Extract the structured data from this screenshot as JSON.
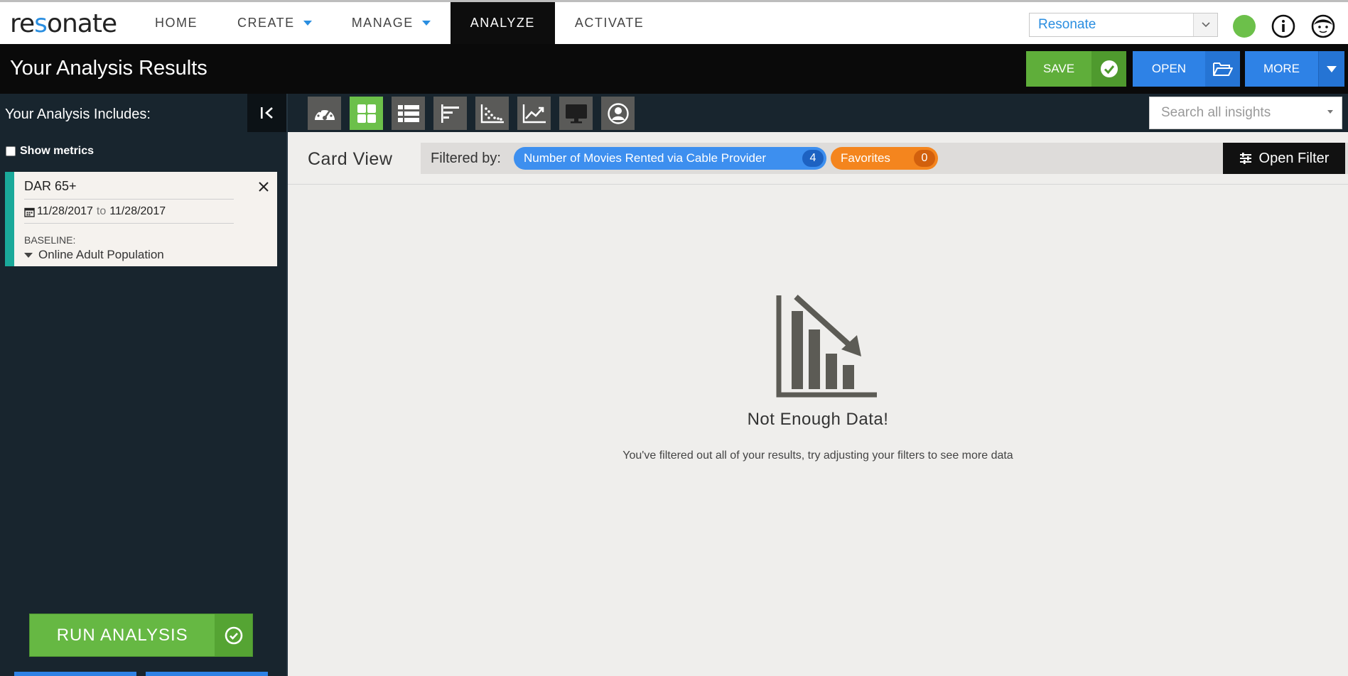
{
  "app": {
    "logo_text_a": "re",
    "logo_text_b": "s",
    "logo_text_c": "onate"
  },
  "nav": {
    "items": [
      {
        "label": "HOME",
        "has_dropdown": false
      },
      {
        "label": "CREATE",
        "has_dropdown": true
      },
      {
        "label": "MANAGE",
        "has_dropdown": true
      },
      {
        "label": "ANALYZE",
        "has_dropdown": false,
        "active": true
      },
      {
        "label": "ACTIVATE",
        "has_dropdown": false
      }
    ],
    "org_select": "Resonate",
    "status_color": "#6cc04a"
  },
  "header": {
    "title": "Your Analysis Results",
    "save_label": "SAVE",
    "open_label": "OPEN",
    "more_label": "MORE"
  },
  "sidebar": {
    "title": "Your Analysis Includes:",
    "show_metrics_label": "Show metrics",
    "show_metrics_checked": false,
    "segment": {
      "name": "DAR 65+",
      "start_date": "11/28/2017",
      "to_label": "to",
      "end_date": "11/28/2017",
      "baseline_label": "BASELINE:",
      "baseline_value": "Online Adult Population",
      "accent_color": "#1aa99a"
    },
    "run_label": "RUN ANALYSIS"
  },
  "toolbar": {
    "views": [
      {
        "icon": "dashboard-gauge-icon",
        "active": false
      },
      {
        "icon": "card-grid-icon",
        "active": true
      },
      {
        "icon": "list-view-icon",
        "active": false
      },
      {
        "icon": "bar-chart-icon",
        "active": false
      },
      {
        "icon": "scatter-plot-icon",
        "active": false
      },
      {
        "icon": "trend-line-icon",
        "active": false
      },
      {
        "icon": "monitor-icon",
        "active": false
      },
      {
        "icon": "persona-icon",
        "active": false
      }
    ],
    "search_placeholder": "Search all insights"
  },
  "main": {
    "view_title": "Card View",
    "filtered_by_label": "Filtered by:",
    "filters": [
      {
        "label": "Number of Movies Rented via Cable Provider",
        "count": "4",
        "color": "#3d8fef"
      },
      {
        "label": "Favorites",
        "count": "0",
        "color": "#f4851e"
      }
    ],
    "open_filter_label": "Open Filter",
    "empty_title": "Not Enough Data!",
    "empty_message": "You've filtered out all of your results, try adjusting your filters to see more data"
  }
}
